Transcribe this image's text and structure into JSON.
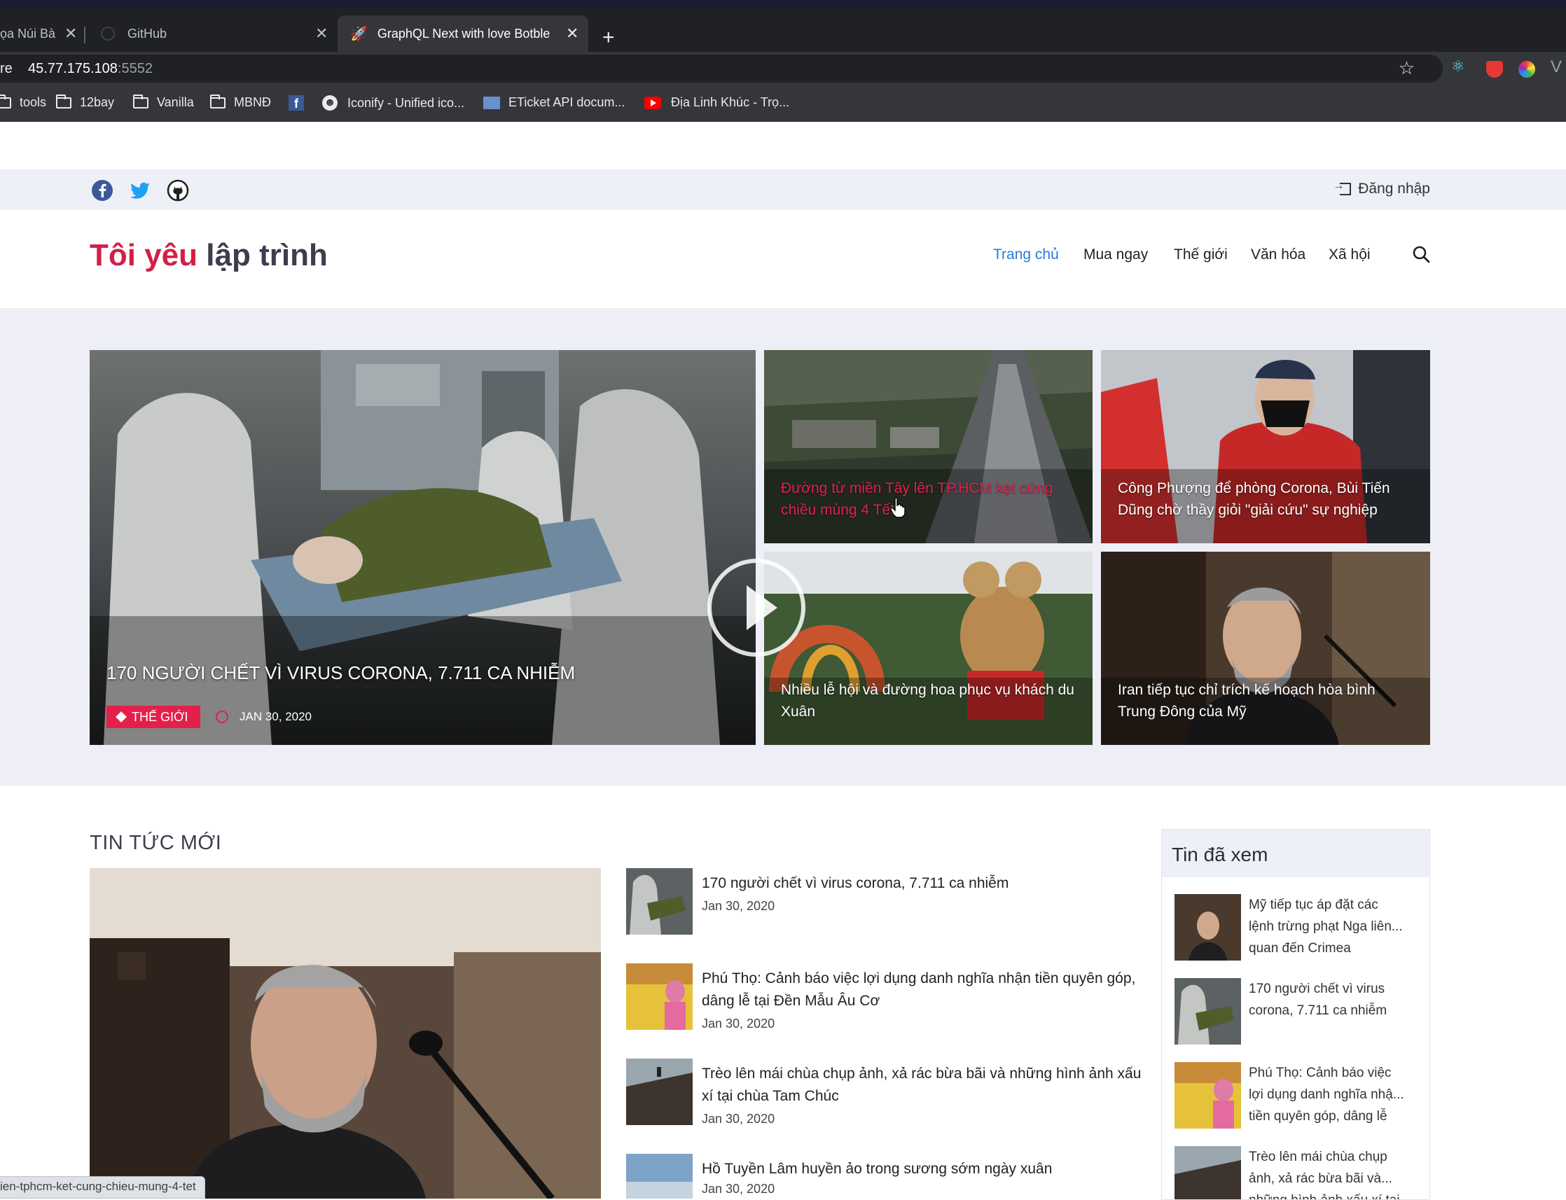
{
  "browser": {
    "tabs": [
      {
        "title": "ọa Núi Bà",
        "active": false
      },
      {
        "title": "GitHub",
        "active": false
      },
      {
        "title": "GraphQL Next with love Botble",
        "active": true
      }
    ],
    "tab_close": "✕",
    "new_tab": "+",
    "url_prefix": "re",
    "url_host": "45.77.175.108",
    "url_port": ":5552",
    "star": "☆",
    "bookmarks": [
      {
        "label": "tools",
        "icon": "folder-icon"
      },
      {
        "label": "12bay",
        "icon": "folder-icon"
      },
      {
        "label": "Vanilla",
        "icon": "folder-icon"
      },
      {
        "label": "MBNĐ",
        "icon": "folder-icon"
      },
      {
        "label": "",
        "icon": "facebook-icon"
      },
      {
        "label": "Iconify - Unified ico...",
        "icon": "smiley-icon"
      },
      {
        "label": "ETicket API docum...",
        "icon": "eticket-icon"
      },
      {
        "label": "Địa Linh Khúc - Trọ...",
        "icon": "youtube-icon"
      }
    ],
    "status_url": "ien-tphcm-ket-cung-chieu-mung-4-tet"
  },
  "site": {
    "social": [
      "facebook-icon",
      "twitter-icon",
      "github-icon"
    ],
    "login_label": "Đăng nhập",
    "brand_part1": "Tôi yêu",
    "brand_part2": "lập trình",
    "nav": [
      "Trang chủ",
      "Mua ngay",
      "Thế giới",
      "Văn hóa",
      "Xã hội"
    ],
    "nav_active": "Trang chủ",
    "hero": {
      "main": {
        "title": "170 NGƯỜI CHẾT VÌ VIRUS CORONA, 7.711 CA NHIỄM",
        "category": "THẾ GIỚI",
        "date": "JAN 30, 2020"
      },
      "cards": [
        {
          "title": "Đường từ miền Tây lên TP.HCM kẹt cứng chiều mùng 4 Tết",
          "hovered": true
        },
        {
          "title": "Công Phượng để phòng Corona, Bùi Tiến Dũng chờ thầy giỏi \"giải cứu\" sự nghiệp"
        },
        {
          "title": "Nhiều lễ hội và đường hoa phục vụ khách du Xuân"
        },
        {
          "title": "Iran tiếp tục chỉ trích kế hoạch hòa bình Trung Đông của Mỹ"
        }
      ]
    },
    "latest": {
      "heading": "TIN TỨC MỚI",
      "items": [
        {
          "title": "170 người chết vì virus corona, 7.711 ca nhiễm",
          "date": "Jan 30, 2020"
        },
        {
          "title": "Phú Thọ: Cảnh báo việc lợi dụng danh nghĩa nhận tiền quyên góp, dâng lễ tại Đền Mẫu Âu Cơ",
          "date": "Jan 30, 2020"
        },
        {
          "title": "Trèo lên mái chùa chụp ảnh, xả rác bừa bãi và những hình ảnh xấu xí tại chùa Tam Chúc",
          "date": "Jan 30, 2020"
        },
        {
          "title": "Hồ Tuyền Lâm huyền ảo trong sương sớm ngày xuân",
          "date": "Jan 30, 2020"
        }
      ]
    },
    "seen": {
      "heading": "Tin đã xem",
      "items": [
        {
          "line1": "Mỹ tiếp tục áp đặt các",
          "line2": "lệnh trừng phạt Nga liên...",
          "line3": "quan đến Crimea"
        },
        {
          "line1": "170 người chết vì virus",
          "line2": "corona, 7.711 ca nhiễm",
          "line3": ""
        },
        {
          "line1": "Phú Thọ: Cảnh báo việc",
          "line2": "lợi dụng danh nghĩa nhậ...",
          "line3": "tiền quyên góp, dâng lễ"
        },
        {
          "line1": "Trèo lên mái chùa chụp",
          "line2": "ảnh, xả rác bừa bãi và...",
          "line3": "những hình ảnh xấu xí tại"
        }
      ]
    }
  },
  "colors": {
    "brand_red": "#d21f47",
    "nav_active": "#2b7bd8",
    "badge": "#e4204a",
    "band": "#edeef6"
  }
}
